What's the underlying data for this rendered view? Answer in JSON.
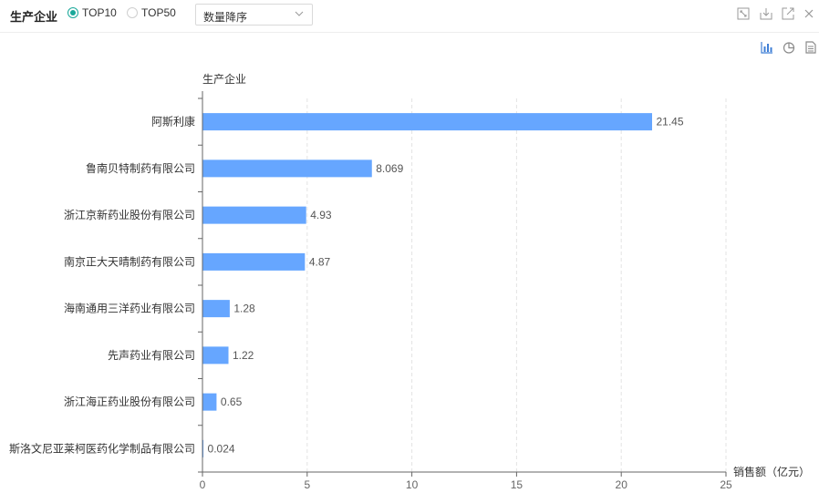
{
  "toolbar": {
    "title": "生产企业",
    "options": [
      {
        "label": "TOP10",
        "checked": true
      },
      {
        "label": "TOP50",
        "checked": false
      }
    ],
    "sort_select": {
      "value": "数量降序"
    },
    "window_icons": [
      "fullscreen-icon",
      "download-icon",
      "open-external-icon",
      "close-icon"
    ]
  },
  "view_icons": [
    "bar-chart-icon",
    "pie-chart-icon",
    "table-view-icon"
  ],
  "colors": {
    "bar": "#66a6ff",
    "accent": "#1aa89a",
    "grid": "#e3e3e3",
    "axis": "#666666"
  },
  "chart_data": {
    "type": "bar",
    "orientation": "horizontal",
    "ylabel": "生产企业",
    "xlabel": "销售额（亿元）",
    "categories": [
      "阿斯利康",
      "鲁南贝特制药有限公司",
      "浙江京新药业股份有限公司",
      "南京正大天晴制药有限公司",
      "海南通用三洋药业有限公司",
      "先声药业有限公司",
      "浙江海正药业股份有限公司",
      "斯洛文尼亚莱柯医药化学制品有限公司"
    ],
    "values": [
      21.45,
      8.069,
      4.93,
      4.87,
      1.28,
      1.22,
      0.65,
      0.024
    ],
    "value_labels": [
      "21.45",
      "8.069",
      "4.93",
      "4.87",
      "1.28",
      "1.22",
      "0.65",
      "0.024"
    ],
    "xlim": [
      0,
      25
    ],
    "xticks": [
      0,
      5,
      10,
      15,
      20,
      25
    ],
    "grid": "vertical dashed"
  }
}
